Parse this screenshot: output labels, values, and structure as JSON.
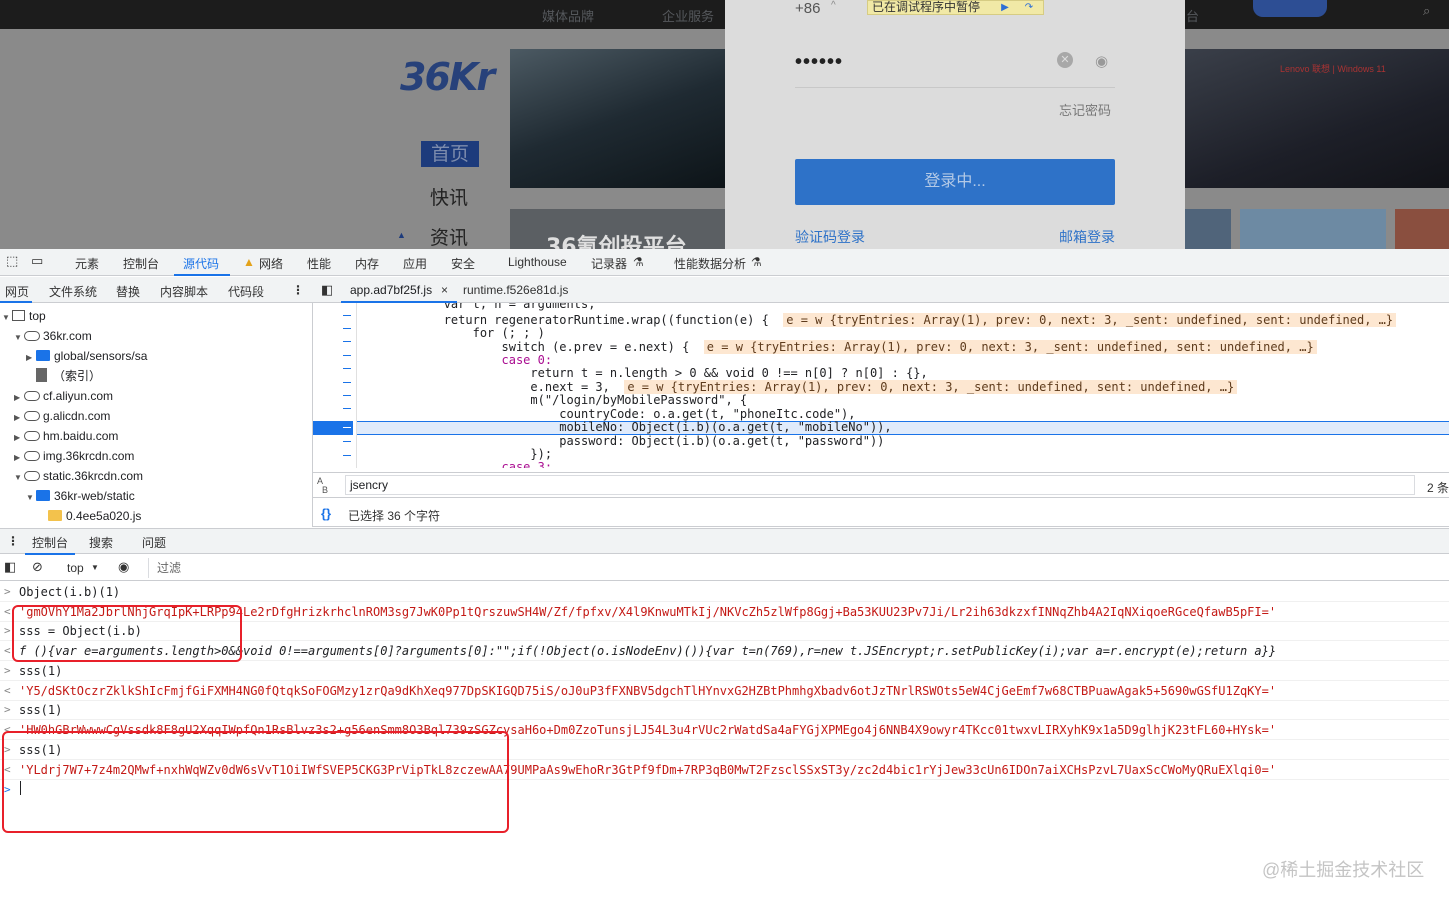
{
  "website": {
    "nav_items": [
      "媒体品牌",
      "企业服务",
      "台"
    ],
    "logo_text": "36Kr",
    "side_nav": [
      "首页",
      "快讯",
      "资讯"
    ],
    "banner_text": "36氪创投平台",
    "ad_text": "Lenovo 联想 | Windows 11",
    "login": {
      "country_code": "+86",
      "paused_label": "已在调试程序中暂停",
      "password_mask": "••••••",
      "forgot_password": "忘记密码",
      "login_button": "登录中...",
      "code_login": "验证码登录",
      "mail_login": "邮箱登录"
    }
  },
  "devtools": {
    "main_tabs": [
      "元素",
      "控制台",
      "源代码",
      "网络",
      "性能",
      "内存",
      "应用",
      "安全",
      "Lighthouse",
      "记录器",
      "性能数据分析"
    ],
    "active_tab": "源代码",
    "sources_tabs": [
      "网页",
      "文件系统",
      "替换",
      "内容脚本",
      "代码段"
    ],
    "file_tree": [
      {
        "label": "top",
        "depth": 0,
        "kind": "frame",
        "arrow": "▼"
      },
      {
        "label": "36kr.com",
        "depth": 1,
        "kind": "cloud",
        "arrow": "▼"
      },
      {
        "label": "global/sensors/sa",
        "depth": 2,
        "kind": "folder",
        "arrow": "▶"
      },
      {
        "label": "（索引）",
        "depth": 2,
        "kind": "file",
        "arrow": ""
      },
      {
        "label": "cf.aliyun.com",
        "depth": 1,
        "kind": "cloud",
        "arrow": "▶"
      },
      {
        "label": "g.alicdn.com",
        "depth": 1,
        "kind": "cloud",
        "arrow": "▶"
      },
      {
        "label": "hm.baidu.com",
        "depth": 1,
        "kind": "cloud",
        "arrow": "▶"
      },
      {
        "label": "img.36krcdn.com",
        "depth": 1,
        "kind": "cloud",
        "arrow": "▶"
      },
      {
        "label": "static.36krcdn.com",
        "depth": 1,
        "kind": "cloud",
        "arrow": "▼"
      },
      {
        "label": "36kr-web/static",
        "depth": 2,
        "kind": "folder",
        "arrow": "▼"
      },
      {
        "label": "0.4ee5a020.js",
        "depth": 3,
        "kind": "jsfile",
        "arrow": ""
      }
    ],
    "editor_tabs": [
      {
        "label": "app.ad7bf25f.js",
        "active": true
      },
      {
        "label": "runtime.f526e81d.js",
        "active": false
      }
    ],
    "search_value": "jsencry",
    "search_count": "2 条",
    "status_text": "已选择 36 个字符",
    "drawer_tabs": [
      "控制台",
      "搜索",
      "问题"
    ],
    "console_context": "top",
    "filter_placeholder": "过滤"
  },
  "code_lines": {
    "l0": "            var t, n = arguments;",
    "l1a": "            return regeneratorRuntime.wrap((function(e) {",
    "l1v": "e = w {tryEntries: Array(1), prev: 0, next: 3, _sent: undefined, sent: undefined, …}",
    "l2": "                for (; ; )",
    "l3a": "                    switch (e.prev = e.next) {",
    "l3v": "e = w {tryEntries: Array(1), prev: 0, next: 3, _sent: undefined, sent: undefined, …}",
    "l4": "                    case 0:",
    "l5": "                        return t = n.length > 0 && void 0 !== n[0] ? n[0] : {},",
    "l6a": "                        e.next = 3,",
    "l6v": "e = w {tryEntries: Array(1), prev: 0, next: 3, _sent: undefined, sent: undefined, …}",
    "l7": "                        m(\"/login/byMobilePassword\", {",
    "l8": "                            countryCode: o.a.get(t, \"phoneItc.code\"),",
    "l9": "                            mobileNo: Object(i.b)(o.a.get(t, \"mobileNo\")),",
    "l10": "                            password: Object(i.b)(o.a.get(t, \"password\"))",
    "l11": "                        });",
    "l12": "                    case 3:"
  },
  "console_lines": [
    {
      "kind": "in",
      "text": "Object(i.b)(1)"
    },
    {
      "kind": "out",
      "text": "'gmOVhY1Ma2JbrlNhjGrqIpK+LRPp94Le2rDfgHrizkrhclnROM3sg7JwK0Pp1tQrszuwSH4W/Zf/fpfxv/X4l9KnwuMTkIj/NKVcZh5zlWfp8Ggj+Ba53KUU23Pv7Ji/Lr2ih63dkzxfINNqZhb4A2IqNXiqoeRGceQfawB5pFI='"
    },
    {
      "kind": "in",
      "text": "sss = Object(i.b)"
    },
    {
      "kind": "fout",
      "text": "f (){var e=arguments.length>0&&void 0!==arguments[0]?arguments[0]:\"\";if(!Object(o.isNodeEnv)()){var t=n(769),r=new t.JSEncrypt;r.setPublicKey(i);var a=r.encrypt(e);return a}}"
    },
    {
      "kind": "in",
      "text": "sss(1)"
    },
    {
      "kind": "out",
      "text": "'Y5/dSKtOczrZklkShIcFmjfGiFXMH4NG0fQtqkSoFOGMzy1zrQa9dKhXeq977DpSKIGQD75iS/oJ0uP3fFXNBV5dgchTlHYnvxG2HZBtPhmhgXbadv6otJzTNrlRSWOts5eW4CjGeEmf7w68CTBPuawAgak5+5690wGSfU1ZqKY='"
    },
    {
      "kind": "in",
      "text": "sss(1)"
    },
    {
      "kind": "out",
      "text": "'HW0hGBrWwwwCgVssdk8F8gU2XqqIWpfQn1RsBlvz3s2+g56enSmm8O3Bql739zSGZcysaH6o+Dm0ZzoTunsjLJ54L3u4rVUc2rWatdSa4aFYGjXPMEgo4j6NNB4X9owyr4TKcc01twxvLIRXyhK9x1a5D9glhjK23tFL60+HYsk='"
    },
    {
      "kind": "in",
      "text": "sss(1)"
    },
    {
      "kind": "out",
      "text": "'YLdrj7W7+7z4m2QMwf+nxhWqWZv0dW6sVvT1OiIWfSVEP5CKG3PrVipTkL8zczewAA79UMPaAs9wEhoRr3GtPf9fDm+7RP3qB0MwT2FzsclSSxST3y/zc2d4bic1rYjJew33cUn6IDOn7aiXCHsPzvL7UaxScCWoMyQRuEXlqi0='"
    }
  ],
  "watermark": "@稀土掘金技术社区",
  "colors": {
    "accent": "#1a73e8",
    "string": "#c41a16",
    "highlight": "#e8202a"
  }
}
